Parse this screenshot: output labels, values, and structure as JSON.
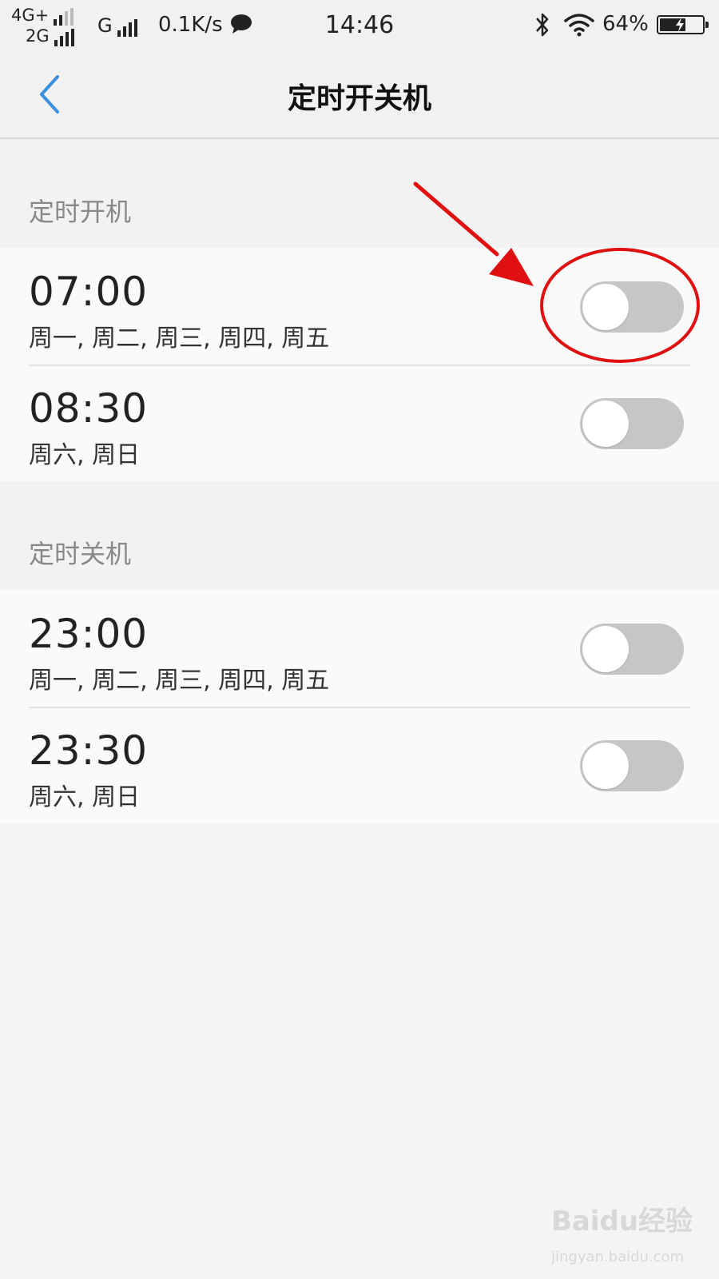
{
  "status_bar": {
    "net_top": "4G+",
    "net_bottom": "2G",
    "net_g": "G",
    "speed": "0.1K/s",
    "time": "14:46",
    "battery_pct": "64%",
    "battery_level": 0.64
  },
  "header": {
    "title": "定时开关机"
  },
  "power_on": {
    "section_label": "定时开机",
    "items": [
      {
        "time": "07:00",
        "days": "周一, 周二, 周三, 周四, 周五",
        "enabled": false
      },
      {
        "time": "08:30",
        "days": "周六, 周日",
        "enabled": false
      }
    ]
  },
  "power_off": {
    "section_label": "定时关机",
    "items": [
      {
        "time": "23:00",
        "days": "周一, 周二, 周三, 周四, 周五",
        "enabled": false
      },
      {
        "time": "23:30",
        "days": "周六, 周日",
        "enabled": false
      }
    ]
  },
  "colors": {
    "accent_back": "#3a8fe0",
    "annotation_red": "#e01010",
    "toggle_off": "#c6c6c6"
  },
  "watermark": {
    "brand": "Baidu经验",
    "url": "jingyan.baidu.com"
  }
}
